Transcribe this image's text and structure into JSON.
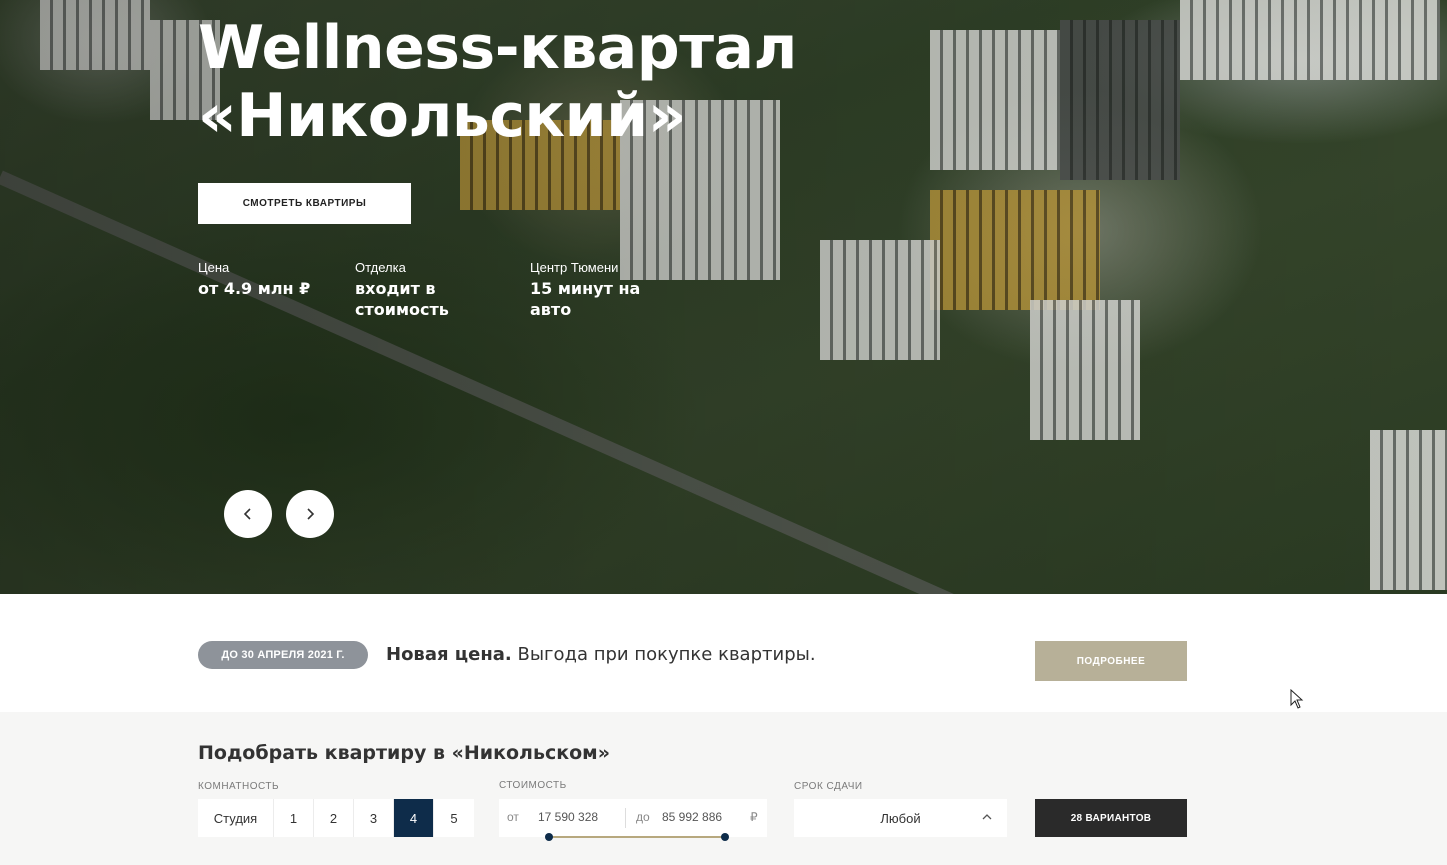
{
  "hero": {
    "title_line1": "Wellness-квартал",
    "title_line2": "«Никольский»",
    "cta_label": "СМОТРЕТЬ КВАРТИРЫ",
    "stats": [
      {
        "label": "Цена",
        "value": "от 4.9 млн ₽"
      },
      {
        "label": "Отделка",
        "value_line1": "входит в",
        "value_line2": "стоимость"
      },
      {
        "label": "Центр Тюмени",
        "value_line1": "15 минут на",
        "value_line2": "авто"
      }
    ],
    "prev_icon": "chevron-left-icon",
    "next_icon": "chevron-right-icon"
  },
  "promo": {
    "badge": "ДО 30 АПРЕЛЯ 2021 Г.",
    "headline_bold": "Новая цена.",
    "headline_rest": " Выгода при покупке квартиры.",
    "button_label": "ПОДРОБНЕЕ"
  },
  "filter": {
    "title": "Подобрать квартиру в «Никольском»",
    "rooms_label": "КОМНАТНОСТЬ",
    "rooms": [
      "Студия",
      "1",
      "2",
      "3",
      "4",
      "5"
    ],
    "rooms_selected": "4",
    "price_label": "СТОИМОСТЬ",
    "price_from_prefix": "от",
    "price_from": "17 590 328",
    "price_to_prefix": "до",
    "price_to": "85 992 886",
    "currency": "₽",
    "deadline_label": "СРОК СДАЧИ",
    "deadline_value": "Любой",
    "results_label": "28 ВАРИАНТОВ"
  },
  "colors": {
    "accent_navy": "#0e2c4a",
    "accent_gold": "#b7b098",
    "badge_gray": "#8e939a",
    "results_dark": "#2a2a2a"
  }
}
